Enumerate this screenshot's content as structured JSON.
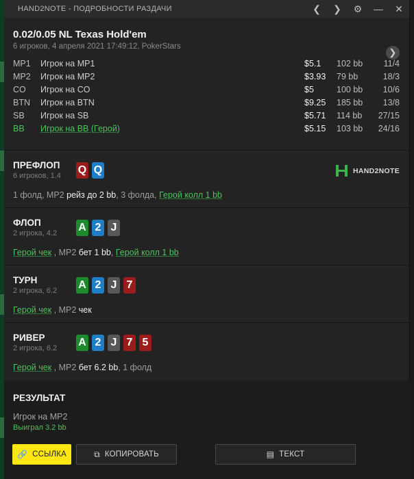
{
  "window": {
    "title": "HAND2NOTE - ПОДРОБНОСТИ РАЗДАЧИ"
  },
  "titlebar_icons": [
    "chevron-left-icon",
    "chevron-right-icon",
    "gear-icon",
    "minimize-icon",
    "close-icon"
  ],
  "hand": {
    "game": "0.02/0.05 NL Texas Hold'em",
    "subtitle": "6 игроков, 4 апреля 2021 17:49:12, PokerStars"
  },
  "players": [
    {
      "pos": "MP1",
      "name": "Игрок на MP1",
      "stack": "$5.1",
      "bb": "102 bb",
      "cards": "11/4"
    },
    {
      "pos": "MP2",
      "name": "Игрок на MP2",
      "stack": "$3.93",
      "bb": "79 bb",
      "cards": "18/3"
    },
    {
      "pos": "CO",
      "name": "Игрок на CO",
      "stack": "$5",
      "bb": "100 bb",
      "cards": "10/6"
    },
    {
      "pos": "BTN",
      "name": "Игрок на BTN",
      "stack": "$9.25",
      "bb": "185 bb",
      "cards": "13/8"
    },
    {
      "pos": "SB",
      "name": "Игрок на SB",
      "stack": "$5.71",
      "bb": "114 bb",
      "cards": "27/15"
    },
    {
      "pos": "BB",
      "name": "Игрок на BB (Герой)",
      "stack": "$5.15",
      "bb": "103 bb",
      "cards": "24/16"
    }
  ],
  "logo_text": "HAND2NOTE",
  "preflop": {
    "title": "ПРЕФЛОП",
    "info": "6 игроков, 1.4",
    "cards": [
      {
        "rank": "Q",
        "color": "#9b1c1c"
      },
      {
        "rank": "Q",
        "color": "#1f7ec8"
      }
    ],
    "a1": "1 фолд, MP2 ",
    "a2": "рейз до 2 bb",
    "a3": ", 3 фолда, ",
    "a4": "Герой колл 1 bb"
  },
  "flop": {
    "title": "ФЛОП",
    "info": "2 игрока, 4.2",
    "cards": [
      {
        "rank": "A",
        "color": "#1e8a2e"
      },
      {
        "rank": "2",
        "color": "#1f7ec8"
      },
      {
        "rank": "J",
        "color": "#585858"
      }
    ],
    "a1": "Герой чек",
    "a2": " , MP2 ",
    "a3": "бет 1 bb",
    "a4": ", ",
    "a5": "Герой колл 1 bb"
  },
  "turn": {
    "title": "ТУРН",
    "info": "2 игрока, 6.2",
    "cards": [
      {
        "rank": "A",
        "color": "#1e8a2e"
      },
      {
        "rank": "2",
        "color": "#1f7ec8"
      },
      {
        "rank": "J",
        "color": "#585858"
      },
      {
        "rank": "7",
        "color": "#9b1c1c"
      }
    ],
    "a1": "Герой чек",
    "a2": " , MP2 ",
    "a3": "чек"
  },
  "river": {
    "title": "РИВЕР",
    "info": "2 игрока, 6.2",
    "cards": [
      {
        "rank": "A",
        "color": "#1e8a2e"
      },
      {
        "rank": "2",
        "color": "#1f7ec8"
      },
      {
        "rank": "J",
        "color": "#585858"
      },
      {
        "rank": "7",
        "color": "#9b1c1c"
      },
      {
        "rank": "5",
        "color": "#9b1c1c"
      }
    ],
    "a1": "Герой чек",
    "a2": " , MP2 ",
    "a3": "бет 6.2 bb",
    "a4": ", 1 фолд"
  },
  "result": {
    "title": "РЕЗУЛЬТАТ",
    "winner": "Игрок на MP2",
    "won": "Выиграл 3.2 bb"
  },
  "buttons": {
    "link": "ССЫЛКА",
    "copy": "КОПИРОВАТЬ",
    "text": "ТЕКСТ"
  },
  "colors": {
    "hero_green": "#4cc35b",
    "link_button": "#ffe812",
    "background": "#232323"
  }
}
